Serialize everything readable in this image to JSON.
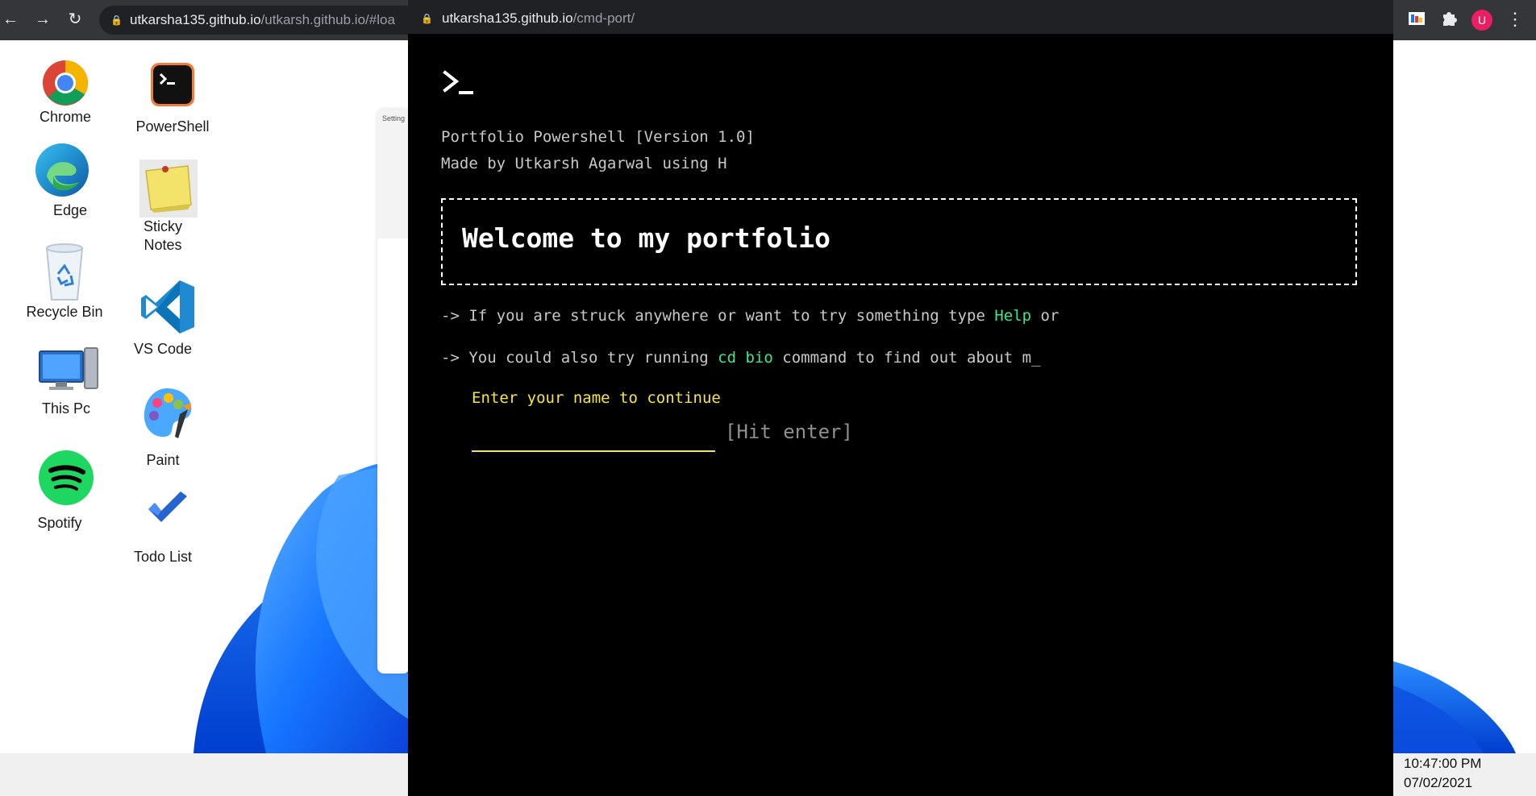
{
  "browser": {
    "back_url_host": "utkarsha135.github.io",
    "back_url_path": "/utkarsh.github.io/#loa",
    "avatar_initial": "U"
  },
  "desktop": {
    "icons_col1": [
      {
        "label": "Chrome",
        "icon": "chrome-icon"
      },
      {
        "label": "Edge",
        "icon": "edge-icon"
      },
      {
        "label": "Recycle Bin",
        "icon": "recycle-bin-icon"
      },
      {
        "label": "This Pc",
        "icon": "this-pc-icon"
      },
      {
        "label": "Spotify",
        "icon": "spotify-icon"
      }
    ],
    "icons_col2": [
      {
        "label": "PowerShell",
        "icon": "powershell-icon"
      },
      {
        "label": "Sticky\nNotes",
        "icon": "sticky-notes-icon"
      },
      {
        "label": "VS Code",
        "icon": "vscode-icon"
      },
      {
        "label": "Paint",
        "icon": "paint-icon"
      },
      {
        "label": "Todo List",
        "icon": "todo-list-icon"
      }
    ],
    "settings_title": "Setting"
  },
  "taskbar": {
    "time": "10:47:00 PM",
    "date": "07/02/2021"
  },
  "terminal": {
    "url_host": "utkarsha135.github.io",
    "url_path": "/cmd-port/",
    "version_line": "Portfolio Powershell [Version 1.0]",
    "made_by_line": "Made by Utkarsh Agarwal using H",
    "welcome": "Welcome to my portfolio",
    "help_prefix": "-> If you are struck anywhere or want to try something type ",
    "help_word": "Help",
    "help_suffix": " or",
    "bio_prefix": "-> You could also try running ",
    "bio_cmd": "cd bio",
    "bio_suffix": " command to find out about m_",
    "name_prompt": "Enter your name to continue",
    "name_value": "",
    "hit_enter": "[Hit enter]"
  },
  "colors": {
    "terminal_bg": "#000000",
    "highlight_green": "#3ee68a",
    "prompt_yellow": "#f5e642",
    "body_text": "#c8c8c8",
    "chrome_dark": "#35363a"
  }
}
